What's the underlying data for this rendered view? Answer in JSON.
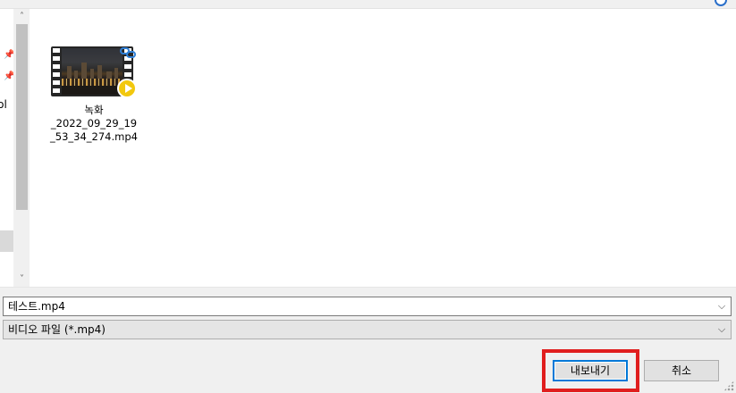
{
  "nav": {
    "partial_label": "rsol"
  },
  "file_list": {
    "items": [
      {
        "name_lines": [
          "녹화",
          "_2022_09_29_19",
          "_53_34_274.mp4"
        ],
        "type_icon": "video-file-thumbnail"
      }
    ]
  },
  "file_name_field": {
    "value": "테스트.mp4"
  },
  "file_type_select": {
    "selected": "비디오 파일 (*.mp4)"
  },
  "buttons": {
    "export_label": "내보내기",
    "cancel_label": "취소"
  },
  "icons": {
    "pin": "pin-icon",
    "scroll_up": "scroll-up-arrow-icon",
    "scroll_down": "scroll-down-arrow-icon",
    "dropdown": "chevron-down-icon",
    "play_badge": "play-badge-icon",
    "link_badge": "link-badge-icon"
  },
  "colors": {
    "highlight": "#e01e1e",
    "primary_border": "#0078d7",
    "play_badge": "#f2c80e"
  }
}
